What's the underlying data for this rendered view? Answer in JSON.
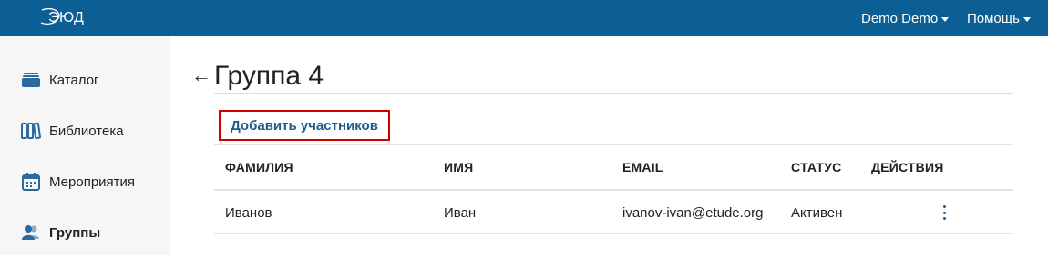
{
  "app": {
    "logo_text": "ЭЮД",
    "brand_color": "#0b5f94",
    "accent_color": "#1e5b8f"
  },
  "header": {
    "user_menu_label": "Demo Demo",
    "help_menu_label": "Помощь"
  },
  "sidebar": {
    "items": [
      {
        "label": "Каталог",
        "icon": "catalog-icon",
        "active": false
      },
      {
        "label": "Библиотека",
        "icon": "library-icon",
        "active": false
      },
      {
        "label": "Мероприятия",
        "icon": "calendar-icon",
        "active": false
      },
      {
        "label": "Группы",
        "icon": "groups-icon",
        "active": true
      }
    ]
  },
  "page": {
    "back_icon": "arrow-left-icon",
    "back_glyph": "←",
    "title": "Группа 4",
    "add_members_label": "Добавить участников"
  },
  "table": {
    "columns": [
      "ФАМИЛИЯ",
      "ИМЯ",
      "EMAIL",
      "СТАТУС",
      "ДЕЙСТВИЯ"
    ],
    "rows": [
      {
        "last_name": "Иванов",
        "first_name": "Иван",
        "email": "ivanov-ivan@etude.org",
        "status": "Активен",
        "actions_icon": "more-vertical-icon"
      }
    ]
  }
}
